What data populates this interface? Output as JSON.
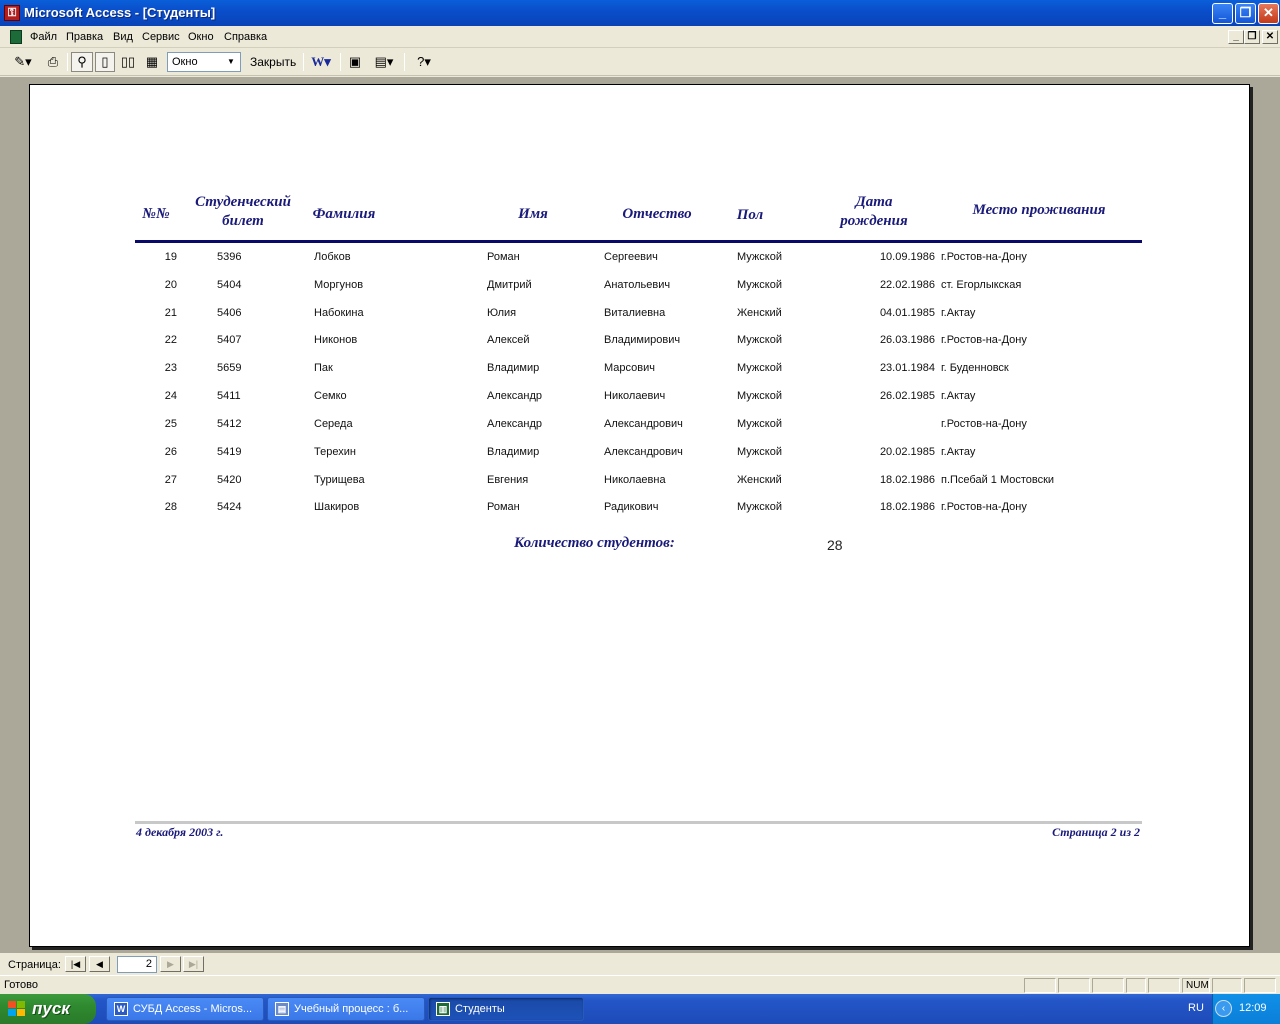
{
  "window": {
    "title": "Microsoft Access - [Студенты]"
  },
  "menu": [
    "Файл",
    "Правка",
    "Вид",
    "Сервис",
    "Окно",
    "Справка"
  ],
  "toolbar": {
    "zoom_value": "Окно",
    "close_label": "Закрыть"
  },
  "report": {
    "headers": {
      "num": "№№",
      "ticket_line1": "Студенческий",
      "ticket_line2": "билет",
      "surname": "Фамилия",
      "name": "Имя",
      "patronymic": "Отчество",
      "gender": "Пол",
      "dob_line1": "Дата",
      "dob_line2": "рождения",
      "residence": "Место проживания"
    },
    "rows": [
      {
        "num": "19",
        "ticket": "5396",
        "surname": "Лобков",
        "name": "Роман",
        "patronymic": "Сергеевич",
        "gender": "Мужской",
        "dob": "10.09.1986",
        "residence": "г.Ростов-на-Дону"
      },
      {
        "num": "20",
        "ticket": "5404",
        "surname": "Моргунов",
        "name": "Дмитрий",
        "patronymic": "Анатольевич",
        "gender": "Мужской",
        "dob": "22.02.1986",
        "residence": "ст. Егорлыкская"
      },
      {
        "num": "21",
        "ticket": "5406",
        "surname": "Набокина",
        "name": "Юлия",
        "patronymic": "Виталиевна",
        "gender": "Женский",
        "dob": "04.01.1985",
        "residence": "г.Актау"
      },
      {
        "num": "22",
        "ticket": "5407",
        "surname": "Никонов",
        "name": "Алексей",
        "patronymic": "Владимирович",
        "gender": "Мужской",
        "dob": "26.03.1986",
        "residence": "г.Ростов-на-Дону"
      },
      {
        "num": "23",
        "ticket": "5659",
        "surname": "Пак",
        "name": "Владимир",
        "patronymic": "Марсович",
        "gender": "Мужской",
        "dob": "23.01.1984",
        "residence": "г. Буденновск"
      },
      {
        "num": "24",
        "ticket": "5411",
        "surname": "Семко",
        "name": "Александр",
        "patronymic": "Николаевич",
        "gender": "Мужской",
        "dob": "26.02.1985",
        "residence": "г.Актау"
      },
      {
        "num": "25",
        "ticket": "5412",
        "surname": "Середа",
        "name": "Александр",
        "patronymic": "Александрович",
        "gender": "Мужской",
        "dob": "",
        "residence": "г.Ростов-на-Дону"
      },
      {
        "num": "26",
        "ticket": "5419",
        "surname": "Терехин",
        "name": "Владимир",
        "patronymic": "Александрович",
        "gender": "Мужской",
        "dob": "20.02.1985",
        "residence": "г.Актау"
      },
      {
        "num": "27",
        "ticket": "5420",
        "surname": "Турищева",
        "name": "Евгения",
        "patronymic": "Николаевна",
        "gender": "Женский",
        "dob": "18.02.1986",
        "residence": "п.Псебай 1 Мостовски"
      },
      {
        "num": "28",
        "ticket": "5424",
        "surname": "Шакиров",
        "name": "Роман",
        "patronymic": "Радикович",
        "gender": "Мужской",
        "dob": "18.02.1986",
        "residence": "г.Ростов-на-Дону"
      }
    ],
    "total_label": "Количество студентов:",
    "total_value": "28",
    "footer_date": "4 декабря 2003 г.",
    "footer_page": "Страница 2 из 2"
  },
  "navigation": {
    "label": "Страница:",
    "current_page": "2"
  },
  "status": {
    "text": "Готово",
    "num": "NUM"
  },
  "taskbar": {
    "start_label": "пуск",
    "tasks": [
      "СУБД Access - Micros...",
      "Учебный процесс : б...",
      "Студенты"
    ],
    "lang": "RU",
    "clock": "12:09"
  }
}
